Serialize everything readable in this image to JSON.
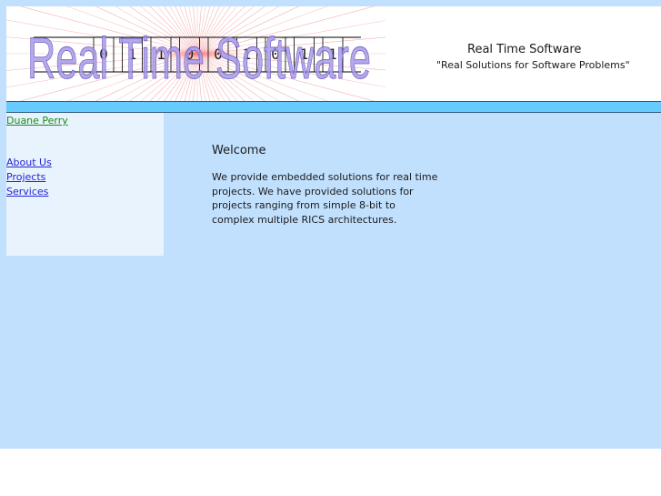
{
  "header": {
    "logo_text": "Real Time Software",
    "logo_bits": [
      "0",
      "1",
      "1",
      "0",
      "0",
      "1",
      "0",
      "1",
      "1"
    ],
    "title": "Real Time Software",
    "tagline": "\"Real Solutions for Software Problems\""
  },
  "sidebar": {
    "owner_link": "Duane Perry",
    "items": [
      {
        "label": "About Us"
      },
      {
        "label": "Projects"
      },
      {
        "label": "Services"
      }
    ]
  },
  "content": {
    "title": "Welcome",
    "body": "We provide embedded solutions for real time projects. We have provided solutions for projects ranging from simple 8-bit to complex multiple RICS architectures."
  },
  "colors": {
    "page_background": "#c1e0fd",
    "nav_bar": "#66ccff",
    "sidebar_background": "#e8f3fe",
    "link": "#2424d6",
    "owner_link": "#1c8a1c",
    "logo_text": "#a89ae6"
  }
}
